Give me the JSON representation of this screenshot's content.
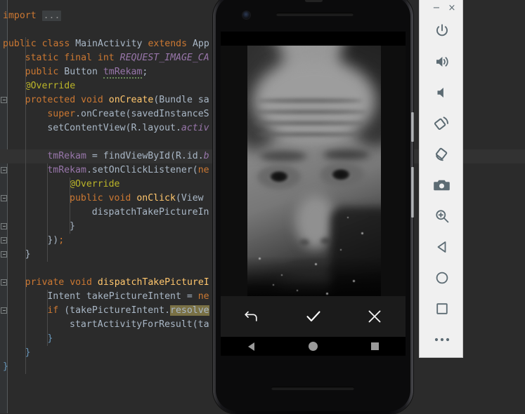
{
  "ide": {
    "name": "android-studio-editor",
    "theme": "darcula",
    "background": "#2b2b2b",
    "gutter_background": "#313335",
    "current_line_background": "#323232",
    "colors": {
      "keyword": "#cc7832",
      "plain_text": "#a9b7c6",
      "field": "#9876aa",
      "annotation": "#bbb529",
      "method": "#ffc66d",
      "number": "#6897bb",
      "string": "#6a8759",
      "search_highlight": "#7a7145"
    },
    "code_lines": [
      {
        "indent": 0,
        "tokens": [
          {
            "t": "import ",
            "c": "kw"
          },
          {
            "t": "...",
            "c": "dots"
          }
        ]
      },
      {
        "indent": 0,
        "tokens": []
      },
      {
        "indent": 0,
        "tokens": [
          {
            "t": "public ",
            "c": "kw"
          },
          {
            "t": "class ",
            "c": "kw"
          },
          {
            "t": "MainActivity ",
            "c": "pl"
          },
          {
            "t": "extends ",
            "c": "kw"
          },
          {
            "t": "App",
            "c": "pl"
          }
        ]
      },
      {
        "indent": 1,
        "tokens": [
          {
            "t": "static ",
            "c": "kw"
          },
          {
            "t": "final ",
            "c": "kw"
          },
          {
            "t": "int ",
            "c": "kw"
          },
          {
            "t": "REQUEST_IMAGE_CA",
            "c": "sfld"
          }
        ]
      },
      {
        "indent": 1,
        "tokens": [
          {
            "t": "public ",
            "c": "kw"
          },
          {
            "t": "Button ",
            "c": "pl"
          },
          {
            "t": "tmRekam",
            "c": "fld squiggle"
          },
          {
            "t": ";",
            "c": "pl"
          }
        ]
      },
      {
        "indent": 1,
        "tokens": [
          {
            "t": "@Override",
            "c": "anno"
          }
        ]
      },
      {
        "indent": 1,
        "tokens": [
          {
            "t": "protected ",
            "c": "kw"
          },
          {
            "t": "void ",
            "c": "kw"
          },
          {
            "t": "onCreate",
            "c": "meth"
          },
          {
            "t": "(Bundle sa",
            "c": "pl"
          }
        ]
      },
      {
        "indent": 2,
        "tokens": [
          {
            "t": "super",
            "c": "kw"
          },
          {
            "t": ".onCreate(savedInstanceS",
            "c": "pl"
          }
        ]
      },
      {
        "indent": 2,
        "tokens": [
          {
            "t": "setContentView(R.layout.",
            "c": "pl"
          },
          {
            "t": "activ",
            "c": "sfld"
          }
        ]
      },
      {
        "indent": 0,
        "tokens": []
      },
      {
        "indent": 2,
        "tokens": [
          {
            "t": "tmRekam",
            "c": "fld"
          },
          {
            "t": " = findViewById(R.id.",
            "c": "pl"
          },
          {
            "t": "b",
            "c": "sfld"
          }
        ],
        "current": true
      },
      {
        "indent": 2,
        "tokens": [
          {
            "t": "tmRekam",
            "c": "fld"
          },
          {
            "t": ".setOnClickListener(",
            "c": "pl"
          },
          {
            "t": "ne",
            "c": "kw"
          }
        ]
      },
      {
        "indent": 3,
        "tokens": [
          {
            "t": "@Override",
            "c": "anno"
          }
        ]
      },
      {
        "indent": 3,
        "tokens": [
          {
            "t": "public ",
            "c": "kw"
          },
          {
            "t": "void ",
            "c": "kw"
          },
          {
            "t": "onClick",
            "c": "meth"
          },
          {
            "t": "(View ",
            "c": "pl"
          }
        ]
      },
      {
        "indent": 4,
        "tokens": [
          {
            "t": "dispatchTakePictureIn",
            "c": "pl"
          }
        ]
      },
      {
        "indent": 3,
        "tokens": [
          {
            "t": "}",
            "c": "pl"
          }
        ]
      },
      {
        "indent": 2,
        "tokens": [
          {
            "t": "})",
            "c": "pl"
          },
          {
            "t": ";",
            "c": "kw"
          }
        ]
      },
      {
        "indent": 1,
        "tokens": [
          {
            "t": "}",
            "c": "pl"
          }
        ]
      },
      {
        "indent": 0,
        "tokens": []
      },
      {
        "indent": 1,
        "tokens": [
          {
            "t": "private ",
            "c": "kw"
          },
          {
            "t": "void ",
            "c": "kw"
          },
          {
            "t": "dispatchTakePictureI",
            "c": "meth"
          }
        ]
      },
      {
        "indent": 2,
        "tokens": [
          {
            "t": "Intent takePictureIntent = ",
            "c": "pl"
          },
          {
            "t": "ne",
            "c": "kw"
          }
        ]
      },
      {
        "indent": 2,
        "tokens": [
          {
            "t": "if ",
            "c": "kw"
          },
          {
            "t": "(takePictureIntent.",
            "c": "pl"
          },
          {
            "t": "resolve",
            "c": "hl"
          }
        ]
      },
      {
        "indent": 3,
        "tokens": [
          {
            "t": "startActivityForResult(ta",
            "c": "pl"
          }
        ]
      },
      {
        "indent": 2,
        "tokens": [
          {
            "t": "}",
            "c": "num"
          }
        ]
      },
      {
        "indent": 1,
        "tokens": [
          {
            "t": "}",
            "c": "num"
          }
        ]
      },
      {
        "indent": 0,
        "tokens": [
          {
            "t": "}",
            "c": "num"
          }
        ]
      }
    ]
  },
  "emulator": {
    "name": "android-emulator",
    "device": "pixel-2",
    "toolbar": {
      "window_controls": [
        {
          "name": "minimize-button",
          "glyph": "−"
        },
        {
          "name": "close-button",
          "glyph": "×"
        }
      ],
      "buttons": [
        {
          "name": "power-button",
          "icon": "power-icon",
          "label": "Power"
        },
        {
          "name": "volume-up-button",
          "icon": "volume-up-icon",
          "label": "Volume Up"
        },
        {
          "name": "volume-down-button",
          "icon": "volume-down-icon",
          "label": "Volume Down"
        },
        {
          "name": "rotate-left-button",
          "icon": "rotate-left-icon",
          "label": "Rotate Left"
        },
        {
          "name": "rotate-right-button",
          "icon": "rotate-right-icon",
          "label": "Rotate Right"
        },
        {
          "name": "screenshot-button",
          "icon": "camera-icon",
          "label": "Take Screenshot"
        },
        {
          "name": "zoom-button",
          "icon": "magnifier-plus-icon",
          "label": "Enable Zoom"
        },
        {
          "name": "back-button",
          "icon": "triangle-back-icon",
          "label": "Back"
        },
        {
          "name": "home-button",
          "icon": "circle-home-icon",
          "label": "Home"
        },
        {
          "name": "overview-button",
          "icon": "square-overview-icon",
          "label": "Overview"
        },
        {
          "name": "extended-controls-button",
          "icon": "ellipsis-icon",
          "label": "More"
        }
      ],
      "icon_color": "#5c6b73",
      "background": "#f0f0f0"
    },
    "screen": {
      "app": "camera-photo-review",
      "preview": {
        "name": "captured-photo-preview",
        "description": "grayscale close-up portrait photograph"
      },
      "action_bar": [
        {
          "name": "retake-button",
          "icon": "undo-arrow-icon",
          "label": "Retake"
        },
        {
          "name": "confirm-button",
          "icon": "checkmark-icon",
          "label": "Accept"
        },
        {
          "name": "cancel-button",
          "icon": "close-x-icon",
          "label": "Cancel"
        }
      ],
      "navigation_bar": [
        {
          "name": "nav-back-button",
          "icon": "triangle-back-icon",
          "label": "Back"
        },
        {
          "name": "nav-home-button",
          "icon": "circle-home-icon",
          "label": "Home"
        },
        {
          "name": "nav-recents-button",
          "icon": "square-recents-icon",
          "label": "Recents"
        }
      ],
      "background": "#000000",
      "action_bar_background": "#1b1b1b"
    }
  }
}
